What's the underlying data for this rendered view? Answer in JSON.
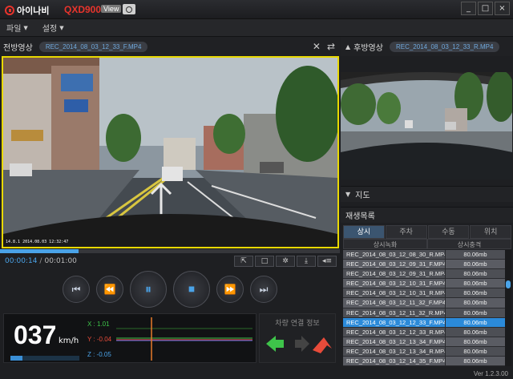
{
  "app": {
    "logo_text": "아이나비",
    "product": "QXD900",
    "product_suffix": "View",
    "window_buttons": [
      "_",
      "□",
      "×"
    ]
  },
  "menu": [
    {
      "label": "파일"
    },
    {
      "label": "설정"
    }
  ],
  "front": {
    "title": "전방영상",
    "file": "REC_2014_08_03_12_33_F.MP4",
    "caption": "14.8.1 2014.08.03 12:32:47"
  },
  "rear": {
    "title": "후방영상",
    "file": "REC_2014_08_03_12_33_R.MP4"
  },
  "playback": {
    "current": "00:00:14",
    "separator": "/",
    "total": "00:01:00",
    "progress": 0.23
  },
  "tools": [
    "⇱",
    "□",
    "✲",
    "⤓",
    "◂≡"
  ],
  "controls": [
    "⏮",
    "⏪",
    "⏸",
    "⏹",
    "⏩",
    "⏭"
  ],
  "speed": {
    "value": "037",
    "unit": "km/h"
  },
  "gsensor": {
    "x": "X : 1.01",
    "y": "Y : -0.04",
    "z": "Z : -0.05"
  },
  "link": {
    "title": "차량 연결 정보"
  },
  "map_section": "지도",
  "list_section": "재생목록",
  "tabs": [
    {
      "label": "상시",
      "active": true
    },
    {
      "label": "주차",
      "active": false
    },
    {
      "label": "수동",
      "active": false
    },
    {
      "label": "위치",
      "active": false
    }
  ],
  "subtabs": [
    "상시녹화",
    "상시충격"
  ],
  "files": [
    {
      "name": "REC_2014_08_03_12_08_30_R.MP4",
      "size": "80.06mb"
    },
    {
      "name": "REC_2014_08_03_12_09_31_F.MP4",
      "size": "80.06mb"
    },
    {
      "name": "REC_2014_08_03_12_09_31_R.MP4",
      "size": "80.06mb"
    },
    {
      "name": "REC_2014_08_03_12_10_31_F.MP4",
      "size": "80.06mb"
    },
    {
      "name": "REC_2014_08_03_12_10_31_R.MP4",
      "size": "80.06mb"
    },
    {
      "name": "REC_2014_08_03_12_11_32_F.MP4",
      "size": "80.06mb"
    },
    {
      "name": "REC_2014_08_03_12_11_32_R.MP4",
      "size": "80.06mb"
    },
    {
      "name": "REC_2014_08_03_12_12_33_F.MP4",
      "size": "80.06mb",
      "selected": true
    },
    {
      "name": "REC_2014_08_03_12_12_33_R.MP4",
      "size": "80.06mb"
    },
    {
      "name": "REC_2014_08_03_12_13_34_F.MP4",
      "size": "80.06mb"
    },
    {
      "name": "REC_2014_08_03_12_13_34_R.MP4",
      "size": "80.06mb"
    },
    {
      "name": "REC_2014_08_03_12_14_35_F.MP4",
      "size": "80.06mb"
    }
  ],
  "version": "Ver 1.2.3.00",
  "colors": {
    "accent": "#4aa3e8",
    "brand": "#e8342c",
    "highlight": "#e8d800"
  }
}
